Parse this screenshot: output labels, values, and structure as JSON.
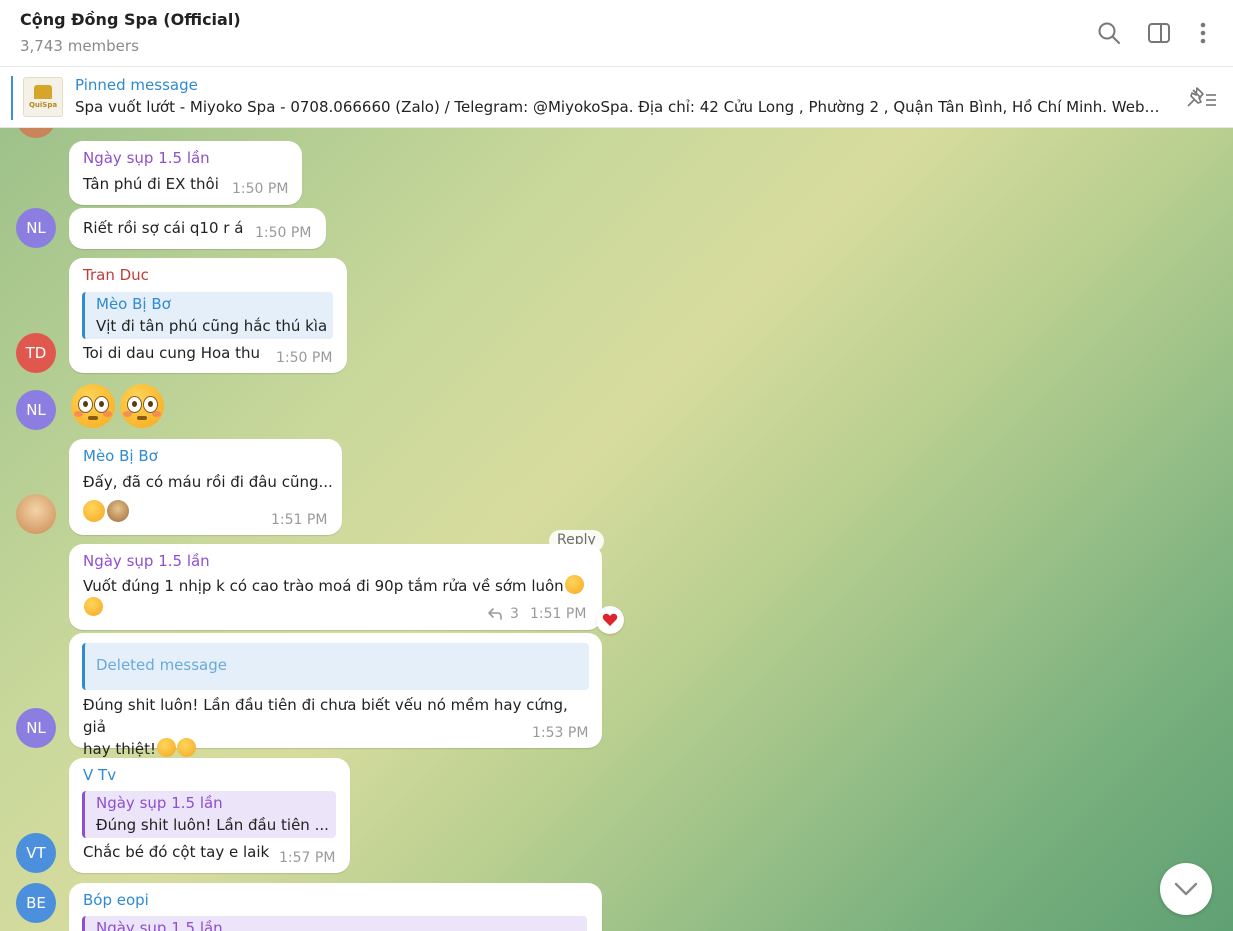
{
  "header": {
    "title": "Cộng Đồng Spa (Official)",
    "members": "3,743 members"
  },
  "pinned": {
    "label": "Pinned message",
    "text": "Spa vuốt lướt  - Miyoko Spa - 0708.066660 (Zalo) / Telegram: @MiyokoSpa.  Địa chỉ: 42 Cửu Long , Phường 2 , Quận Tân Bình, Hồ Chí Minh. Websi...",
    "thumb_text": "QuiSpa"
  },
  "messages": [
    {
      "sender": "Ngày sụp 1.5 lần",
      "text": "Tân phú đi EX thôi",
      "time": "1:50 PM"
    },
    {
      "text": "Riết rồi sợ cái q10 r á",
      "time": "1:50 PM",
      "avatar": "NL"
    },
    {
      "sender": "Tran Duc",
      "quote_name": "Mèo Bị Bơ",
      "quote_text": "Vịt đi tân phú cũng hắc thú kìa",
      "text": "Toi di dau cung Hoa thu",
      "time": "1:50 PM",
      "avatar": "TD"
    },
    {
      "avatar": "NL",
      "sticker": "flushed-emoji"
    },
    {
      "sender": "Mèo Bị Bơ",
      "text": "Đấy, đã có máu rồi đi đâu cũng...",
      "time": "1:51 PM"
    },
    {
      "sender": "Ngày sụp 1.5 lần",
      "text": "Vuốt đúng 1 nhịp k có cao trào moá đi 90p tắm rửa về sớm luôn",
      "time": "1:51 PM",
      "reply_count": "3",
      "reply_label": "Reply"
    },
    {
      "quote_text": "Deleted message",
      "text_line1": "Đúng shit luôn! Lần đầu tiên đi chưa biết vếu nó mềm hay cứng, giả",
      "text_line2": "hay thiệt!",
      "time": "1:53 PM",
      "avatar": "NL"
    },
    {
      "sender": "V Tv",
      "quote_name": "Ngày sụp 1.5 lần",
      "quote_text": "Đúng shit luôn! Lần đầu tiên ...",
      "text": "Chắc bé đó cột tay e laik",
      "time": "1:57 PM",
      "avatar": "VT"
    },
    {
      "sender": "Bóp eopi",
      "quote_name": "Ngày sụp 1.5 lần",
      "avatar": "BE"
    }
  ],
  "colors": {
    "link_blue": "#2f8ad1",
    "purple_name": "#8f4fd0",
    "red_name": "#c03c3c",
    "avatar_purple": "#8c7ee0",
    "avatar_red": "#e0584d",
    "avatar_blue": "#4c8fdc"
  }
}
